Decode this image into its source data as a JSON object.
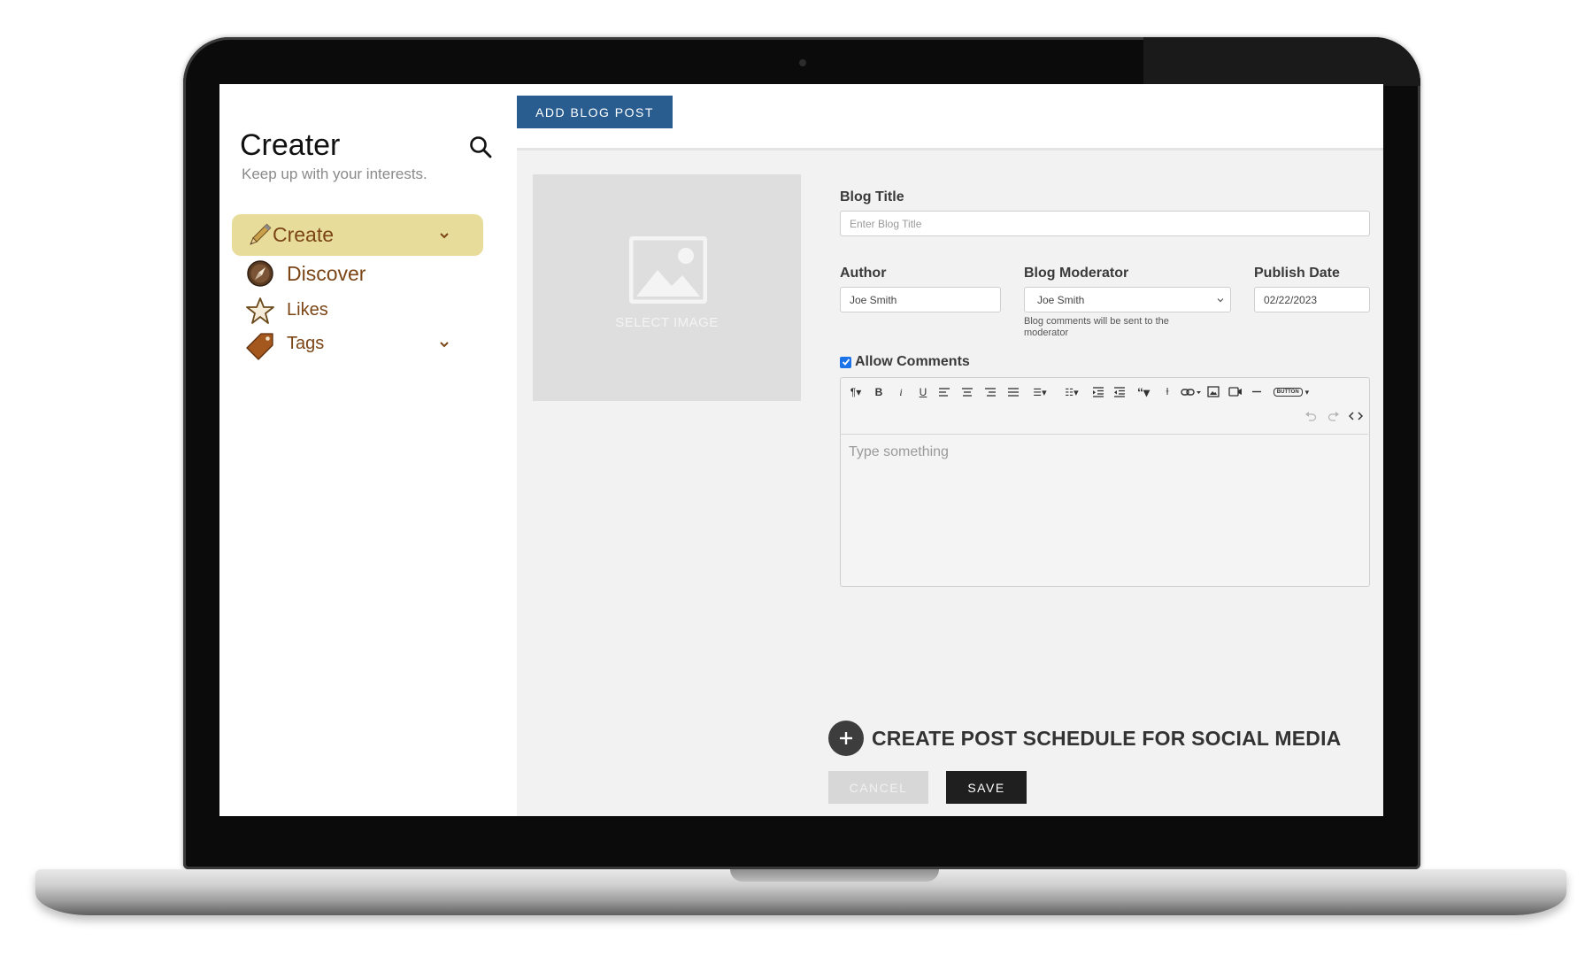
{
  "app": {
    "title": "Creater",
    "tagline": "Keep up with your interests."
  },
  "sidebar": {
    "items": [
      {
        "label": "Create",
        "icon": "pencil-icon",
        "active": true,
        "has_chevron": true
      },
      {
        "label": "Discover",
        "icon": "compass-icon",
        "active": false,
        "has_chevron": false
      },
      {
        "label": "Likes",
        "icon": "star-icon",
        "active": false,
        "has_chevron": false
      },
      {
        "label": "Tags",
        "icon": "tag-icon",
        "active": false,
        "has_chevron": true
      }
    ]
  },
  "header": {
    "add_post_label": "ADD BLOG POST"
  },
  "image_picker": {
    "label": "SELECT IMAGE"
  },
  "form": {
    "blog_title_label": "Blog Title",
    "blog_title_placeholder": "Enter Blog Title",
    "author_label": "Author",
    "author_value": "Joe Smith",
    "moderator_label": "Blog Moderator",
    "moderator_value": "Joe Smith",
    "moderator_hint": "Blog comments will be sent to the moderator",
    "publish_label": "Publish Date",
    "publish_value": "02/22/2023",
    "allow_comments_label": "Allow Comments",
    "allow_comments_checked": true,
    "editor_placeholder": "Type something",
    "toolbar_button_label": "BUTTON",
    "schedule_label": "CREATE POST SCHEDULE FOR SOCIAL MEDIA",
    "cancel_label": "CANCEL",
    "save_label": "SAVE"
  },
  "colors": {
    "accent_blue": "#2a5d8f",
    "nav_active_bg": "#e8dc9a",
    "nav_text": "#7b4516",
    "save_bg": "#1f1f1f"
  }
}
